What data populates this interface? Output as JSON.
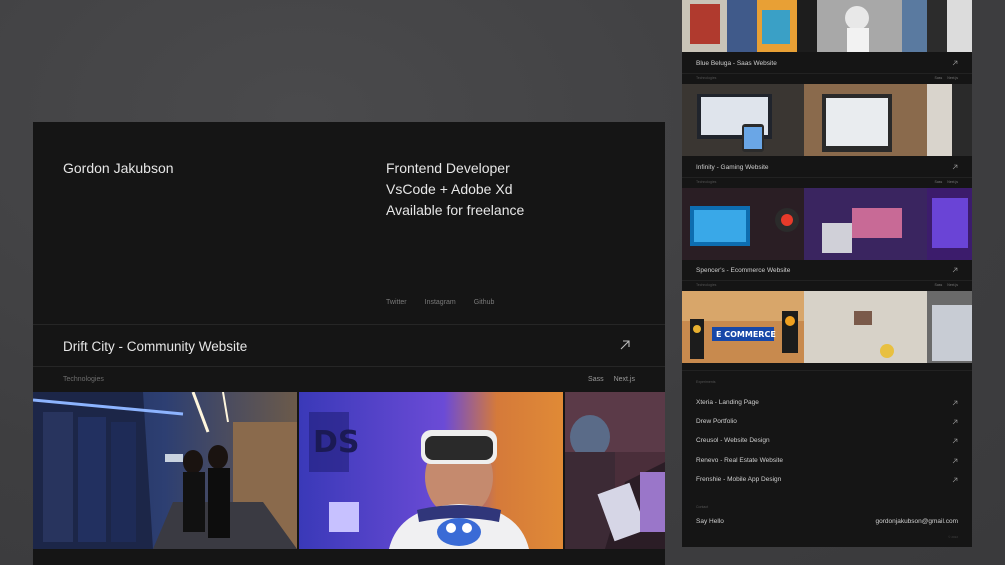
{
  "portfolio": {
    "name": "Gordon Jakubson",
    "roles": [
      "Frontend Developer",
      "VsCode + Adobe Xd",
      "Available for freelance"
    ],
    "social": [
      "Twitter",
      "Instagram",
      "Github"
    ],
    "featured": {
      "title": "Drift City - Community Website",
      "tech_label": "Technologies",
      "tags": [
        "Sass",
        "Next.js"
      ]
    }
  },
  "sidebar": {
    "projects": [
      {
        "title": "Blue Beluga - Saas Website",
        "tech_label": "Technologies",
        "tags": [
          "Sass",
          "Next.js"
        ]
      },
      {
        "title": "Infinity - Gaming Website",
        "tech_label": "Technologies",
        "tags": [
          "Sass",
          "Next.js"
        ]
      },
      {
        "title": "Spencer's - Ecommerce Website",
        "tech_label": "Technologies",
        "tags": [
          "Sass",
          "Next.js"
        ]
      }
    ],
    "sign_text": "E COMMERCE",
    "list_label": "Experiments",
    "list": [
      "Xteria - Landing Page",
      "Drew Portfolio",
      "Creusol - Website Design",
      "Renevo - Real Estate Website",
      "Frenshie - Mobile App Design"
    ],
    "contact_label": "Contact",
    "say_hello": "Say Hello",
    "email": "gordonjakubson@gmail.com",
    "copyright": "© 2022"
  },
  "colors": {
    "background": "#444446",
    "card": "#151515",
    "text": "#e6e6e6",
    "muted": "#7a7a7a"
  }
}
